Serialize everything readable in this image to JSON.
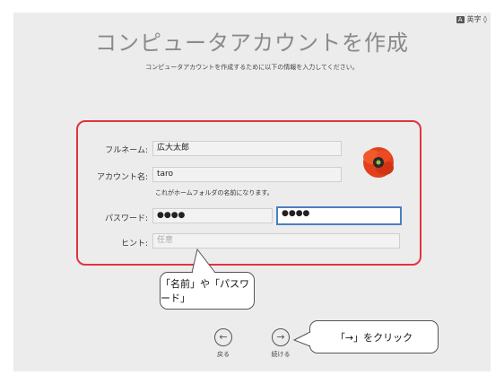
{
  "input_source": {
    "badge": "A",
    "label": "英字 ◊"
  },
  "title": "コンピュータアカウントを作成",
  "subtitle": "コンピュータアカウントを作成するために以下の情報を入力してください。",
  "form": {
    "fullname": {
      "label": "フルネーム:",
      "value": "広大太郎"
    },
    "account": {
      "label": "アカウント名:",
      "value": "taro",
      "note": "これがホームフォルダの名前になります。"
    },
    "password": {
      "label": "パスワード:",
      "value": "●●●●",
      "verify_value": "●●●●"
    },
    "hint": {
      "label": "ヒント:",
      "placeholder": "任意"
    }
  },
  "nav": {
    "back_label": "戻る",
    "continue_label": "続ける"
  },
  "callouts": {
    "fields": "「名前」や「パスワード」",
    "continue": "「→」をクリック"
  }
}
